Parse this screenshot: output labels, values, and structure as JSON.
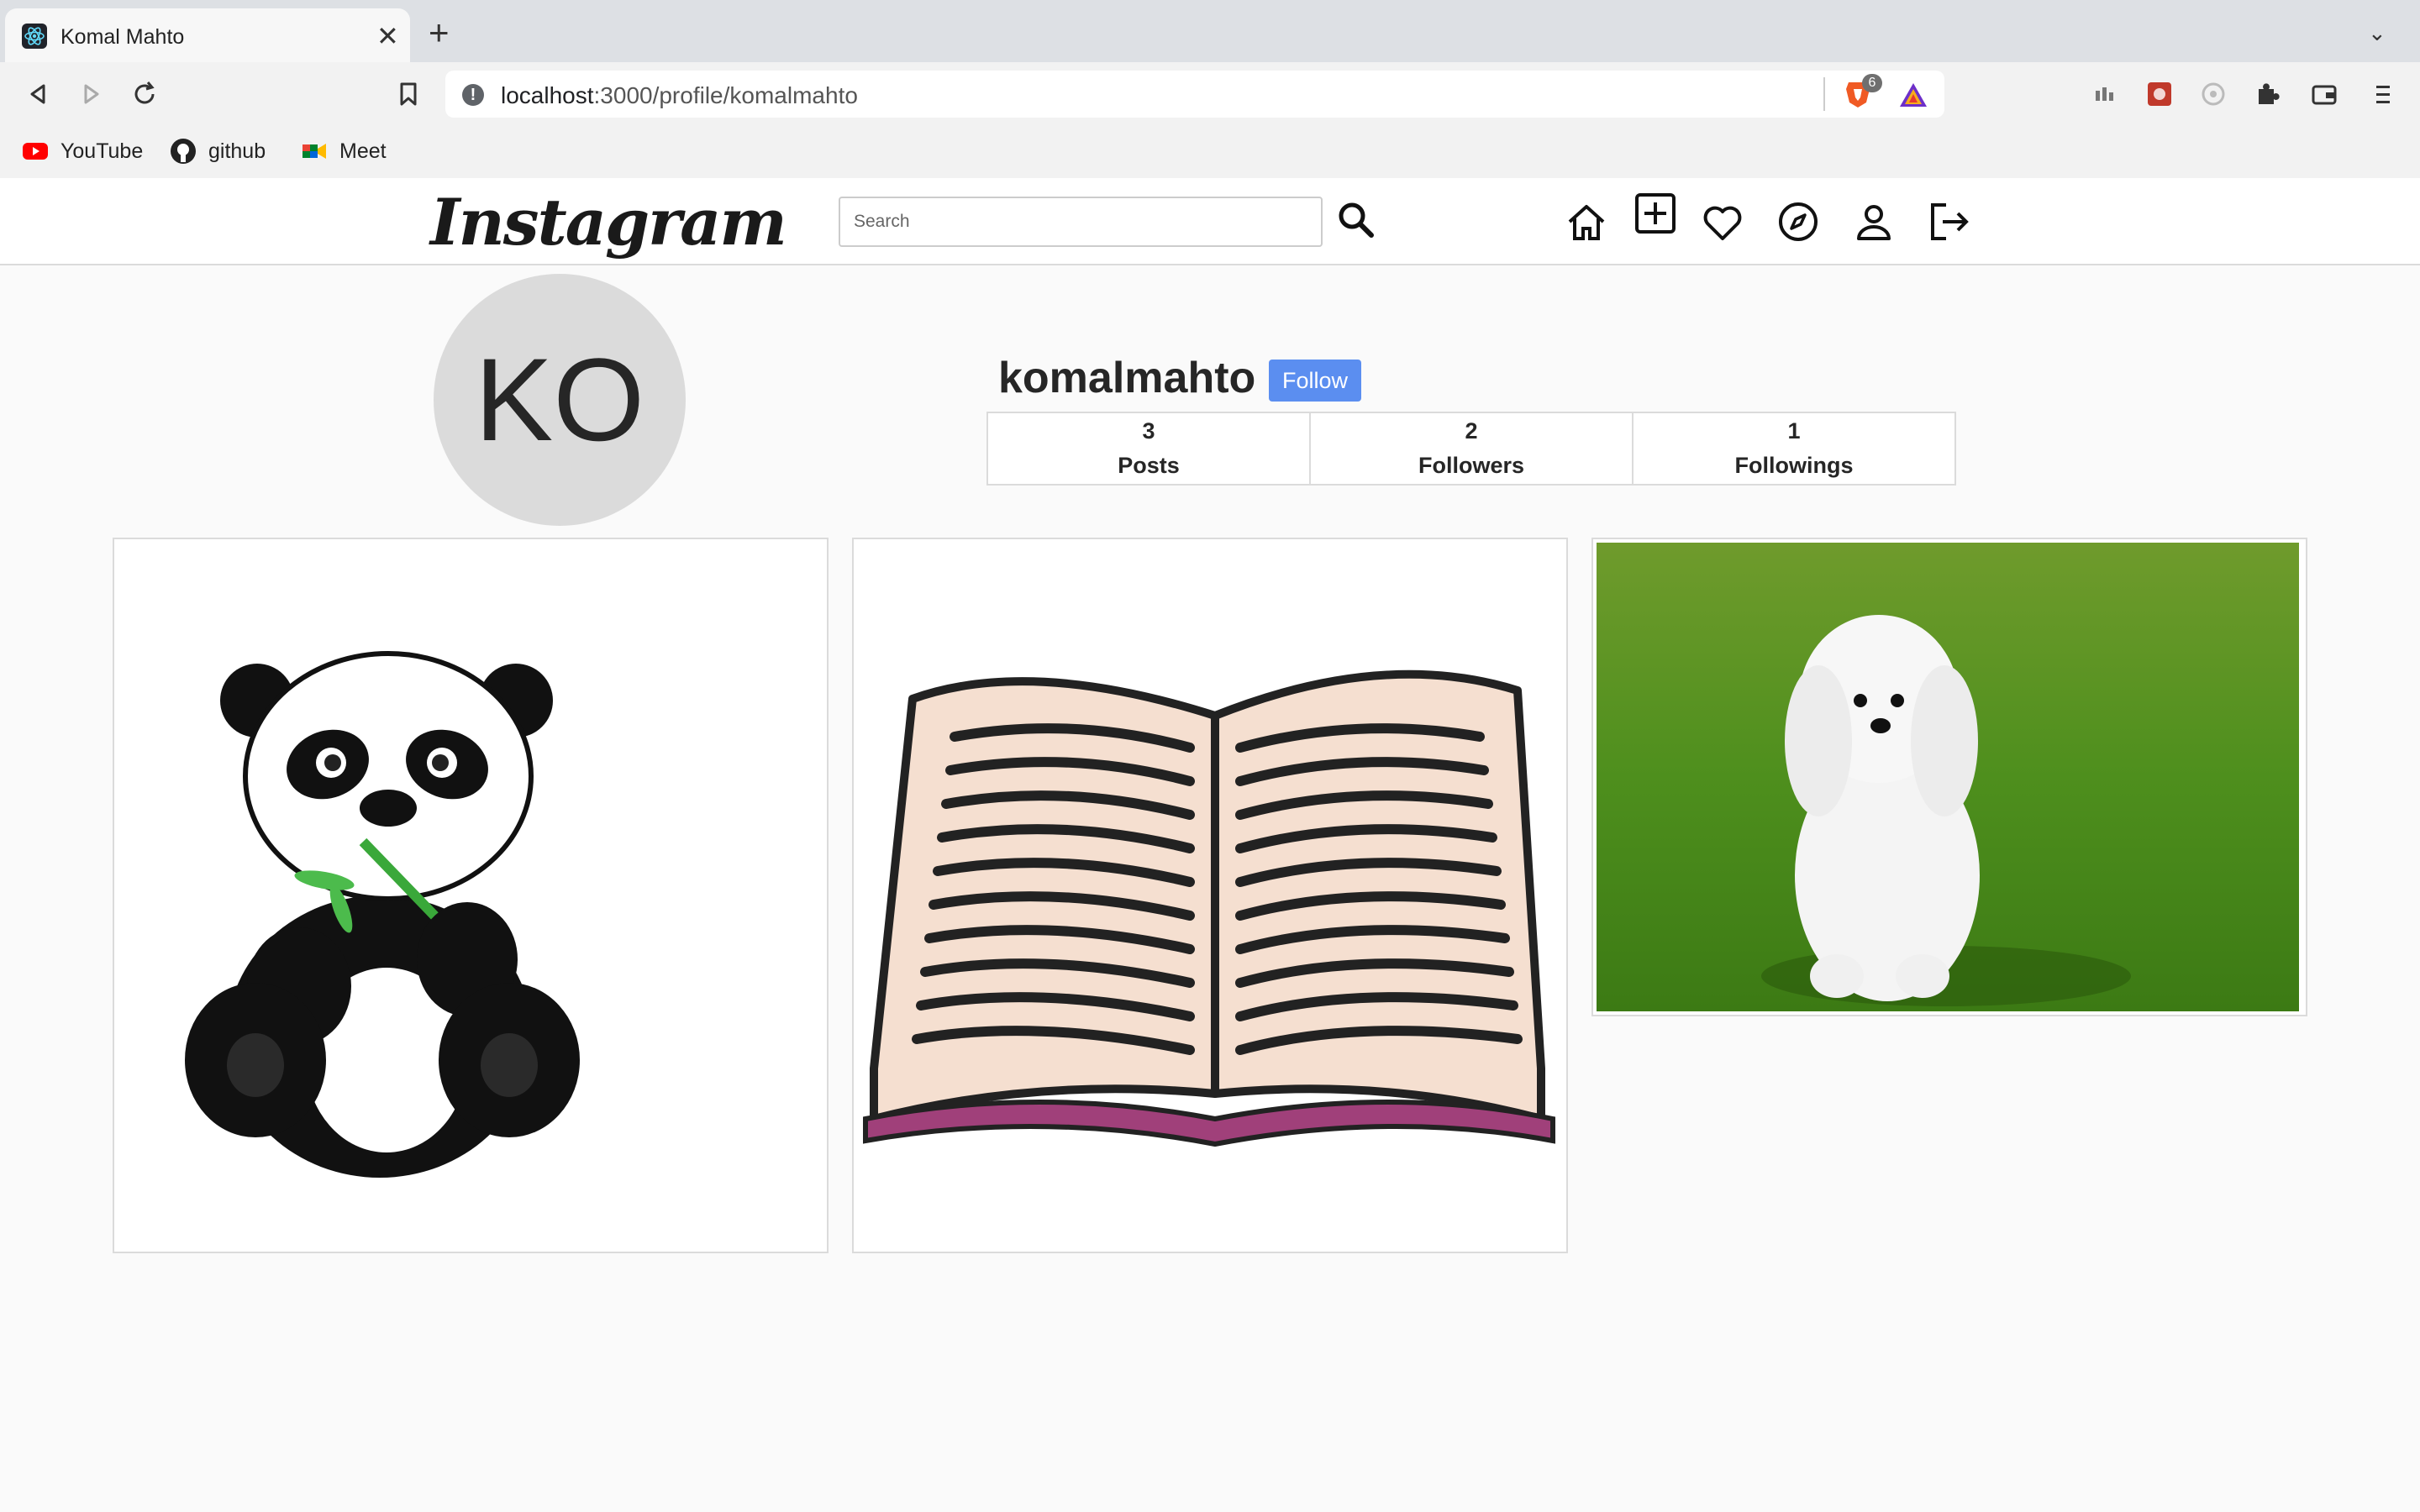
{
  "browser": {
    "tab_title": "Komal Mahto",
    "tab_icon": "react-icon",
    "url_host": "localhost",
    "url_path": ":3000/profile/komalmahto",
    "brave_badge": "6",
    "bookmarks": [
      {
        "label": "YouTube",
        "icon": "youtube-icon"
      },
      {
        "label": "github",
        "icon": "github-icon"
      },
      {
        "label": "Meet",
        "icon": "meet-icon"
      }
    ]
  },
  "app": {
    "logo": "Instagram",
    "search_placeholder": "Search"
  },
  "profile": {
    "avatar_initials": "KO",
    "username": "komalmahto",
    "follow_label": "Follow",
    "stats": [
      {
        "value": "3",
        "label": "Posts"
      },
      {
        "value": "2",
        "label": "Followers"
      },
      {
        "value": "1",
        "label": "Followings"
      }
    ]
  },
  "posts": [
    {
      "subject": "panda"
    },
    {
      "subject": "open-book"
    },
    {
      "subject": "white-dog-on-grass"
    }
  ],
  "colors": {
    "accent": "#5b8ef0",
    "avatar_bg": "#dbdbdb",
    "page_bg": "#fafafa"
  }
}
